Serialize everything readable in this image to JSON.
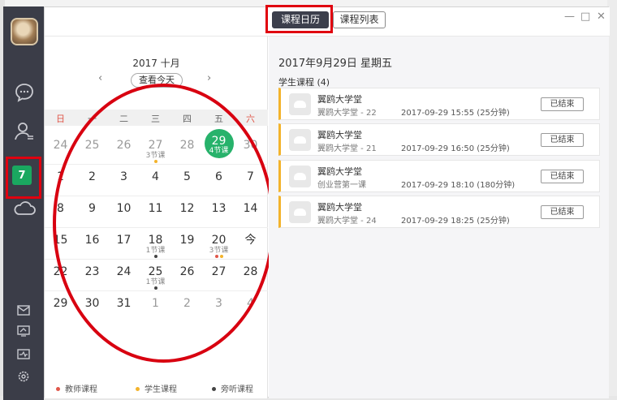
{
  "header": {
    "tabs": [
      {
        "label": "课程日历",
        "active": true
      },
      {
        "label": "课程列表",
        "active": false
      }
    ],
    "window_buttons": [
      "—",
      "□",
      "✕"
    ]
  },
  "sidebar": {
    "icons": [
      "avatar",
      "chat-icon",
      "contacts-icon",
      "calendar-icon",
      "cloud-icon",
      "mail-icon",
      "whiteboard-icon",
      "monitor-icon",
      "settings-icon"
    ],
    "calendar_icon_label": "7"
  },
  "calendar": {
    "month_label": "2017 十月",
    "today_button": "查看今天",
    "prev": "‹",
    "next": "›",
    "weekdays": [
      "日",
      "一",
      "二",
      "三",
      "四",
      "五",
      "六"
    ],
    "weeks": [
      [
        {
          "d": "24",
          "dim": true
        },
        {
          "d": "25",
          "dim": true
        },
        {
          "d": "26",
          "dim": true
        },
        {
          "d": "27",
          "dim": true,
          "sub": "3节课",
          "dots": [
            "#f3b32b"
          ]
        },
        {
          "d": "28",
          "dim": true
        },
        {
          "d": "29",
          "today": true,
          "sub": "4节课",
          "dots": [
            "#f3b32b"
          ]
        },
        {
          "d": "30",
          "dim": true
        }
      ],
      [
        {
          "d": "1"
        },
        {
          "d": "2"
        },
        {
          "d": "3"
        },
        {
          "d": "4"
        },
        {
          "d": "5"
        },
        {
          "d": "6"
        },
        {
          "d": "7"
        }
      ],
      [
        {
          "d": "8"
        },
        {
          "d": "9"
        },
        {
          "d": "10"
        },
        {
          "d": "11"
        },
        {
          "d": "12"
        },
        {
          "d": "13"
        },
        {
          "d": "14"
        }
      ],
      [
        {
          "d": "15"
        },
        {
          "d": "16"
        },
        {
          "d": "17"
        },
        {
          "d": "18",
          "sub": "1节课",
          "dots": [
            "#444444"
          ]
        },
        {
          "d": "19"
        },
        {
          "d": "20",
          "sub": "3节课",
          "dots": [
            "#e0574a",
            "#f3b32b"
          ]
        },
        {
          "d": "今"
        }
      ],
      [
        {
          "d": "22"
        },
        {
          "d": "23"
        },
        {
          "d": "24"
        },
        {
          "d": "25",
          "sub": "1节课",
          "dots": [
            "#444444"
          ]
        },
        {
          "d": "26"
        },
        {
          "d": "27"
        },
        {
          "d": "28"
        }
      ],
      [
        {
          "d": "29"
        },
        {
          "d": "30"
        },
        {
          "d": "31"
        },
        {
          "d": "1",
          "dim": true
        },
        {
          "d": "2",
          "dim": true
        },
        {
          "d": "3",
          "dim": true
        },
        {
          "d": "4",
          "dim": true
        }
      ]
    ],
    "legend": [
      {
        "label": "教师课程",
        "color": "#e0574a"
      },
      {
        "label": "学生课程",
        "color": "#f3b32b"
      },
      {
        "label": "旁听课程",
        "color": "#444444"
      }
    ]
  },
  "detail": {
    "date_title": "2017年9月29日   星期五",
    "section_title": "学生课程 (4)",
    "courses": [
      {
        "title": "翼鸥大学堂",
        "subtitle": "翼鸥大学堂 - 22",
        "time": "2017-09-29 15:55 (25分钟)",
        "status": "已结束"
      },
      {
        "title": "翼鸥大学堂",
        "subtitle": "翼鸥大学堂 - 21",
        "time": "2017-09-29 16:50 (25分钟)",
        "status": "已结束"
      },
      {
        "title": "翼鸥大学堂",
        "subtitle": "创业营第一课",
        "time": "2017-09-29 18:10 (180分钟)",
        "status": "已结束"
      },
      {
        "title": "翼鸥大学堂",
        "subtitle": "翼鸥大学堂 - 24",
        "time": "2017-09-29 18:25 (25分钟)",
        "status": "已结束"
      }
    ]
  },
  "colors": {
    "nav_bg": "#3b3d48",
    "accent_green": "#27b26b",
    "highlight_red": "#e0000f",
    "student_course": "#f3b32b"
  }
}
